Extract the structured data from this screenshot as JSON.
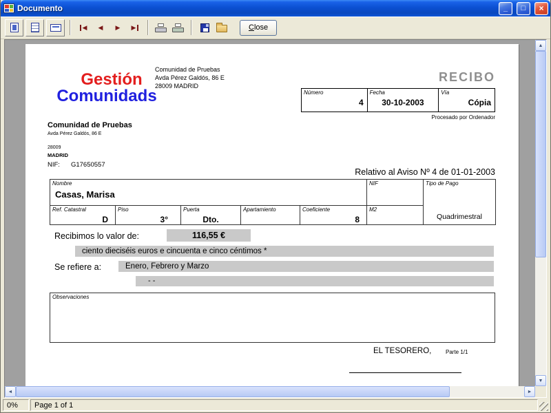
{
  "window": {
    "title": "Documento",
    "controls": {
      "minimize_glyph": "_",
      "maximize_glyph": "□",
      "close_glyph": "×"
    }
  },
  "toolbar": {
    "close_button": {
      "first": "C",
      "rest": "lose"
    },
    "nav": {
      "first": "◀",
      "prev": "◀",
      "next": "▶",
      "last": "▶"
    }
  },
  "scrollbar": {
    "up": "▲",
    "down": "▼",
    "left": "◄",
    "right": "►"
  },
  "statusbar": {
    "progress": "0%",
    "page_info": "Page 1 of 1"
  },
  "colors": {
    "logo_red": "#e31e1e",
    "logo_blue": "#2020df",
    "recibo_gray": "#8f8f8f",
    "highlight_gray": "#c9c9c9",
    "titlebar_blue": "#0b50d2"
  },
  "document": {
    "logo": {
      "line1": "Gestión",
      "line2": "Comunidads"
    },
    "header_address": {
      "line1": "Comunidad de Pruebas",
      "line2": "Avda Pérez Galdós, 86 E",
      "line3": "28009 MADRID"
    },
    "recibo_title": "RECIBO",
    "receipt_meta": {
      "numero_label": "Número",
      "numero_value": "4",
      "fecha_label": "Fecha",
      "fecha_value": "30-10-2003",
      "via_label": "Vía",
      "via_value": "Cópia",
      "processed_note": "Procesado por Ordenador"
    },
    "community": {
      "name": "Comunidad de Pruebas",
      "address": "Avda Pérez Galdós, 86 E",
      "postal": "28009",
      "city": "MADRID",
      "nif_label": "NIF:",
      "nif_value": "G17650557"
    },
    "aviso_line": "Relativo al Aviso Nº 4 de 01-01-2003",
    "owner_table": {
      "nombre_label": "Nombre",
      "nombre_value": "Casas, Marisa",
      "nif_label": "NIF",
      "nif_value": "",
      "tipo_pago_label": "Tipo de Pago",
      "tipo_pago_value": "Quadrimestral",
      "ref_catastral_label": "Ref. Catastral",
      "ref_catastral_value": "D",
      "piso_label": "Piso",
      "piso_value": "3°",
      "puerta_label": "Puerta",
      "puerta_value": "Dto.",
      "apartamiento_label": "Apartamiento",
      "apartamiento_value": "",
      "coeficiente_label": "Coeficiente",
      "coeficiente_value": "8",
      "m2_label": "M2",
      "m2_value": ""
    },
    "amount": {
      "label": "Recibimos lo valor de:",
      "value": "116,55 €",
      "words": "ciento dieciséis euros e cincuenta e cinco céntimos *"
    },
    "refers": {
      "label": "Se refiere a:",
      "value": "Enero, Febrero y Marzo",
      "extra": "- -"
    },
    "observaciones_label": "Observaciones",
    "footer": {
      "tesorero": "EL TESORERO,",
      "parte": "Parte 1/1"
    }
  }
}
